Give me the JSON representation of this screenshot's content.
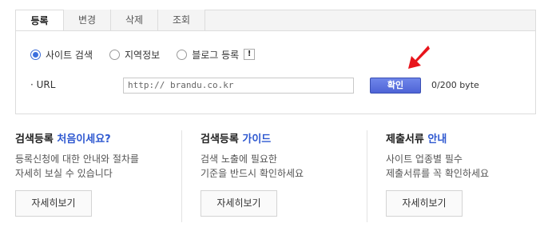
{
  "tabs": [
    {
      "label": "등록",
      "active": true
    },
    {
      "label": "변경",
      "active": false
    },
    {
      "label": "삭제",
      "active": false
    },
    {
      "label": "조회",
      "active": false
    }
  ],
  "form": {
    "radio_options": [
      {
        "label": "사이트 검색",
        "checked": true
      },
      {
        "label": "지역정보",
        "checked": false
      },
      {
        "label": "블로그 등록",
        "checked": false
      }
    ],
    "help_label": "!",
    "url_label": "· URL",
    "url_value": "http:// brandu.co.kr",
    "confirm_label": "확인",
    "byte_count": "0/200 byte"
  },
  "info": [
    {
      "title_prefix": "검색등록 ",
      "title_highlight": "처음이세요?",
      "desc_line1": "등록신청에 대한 안내와 절차를",
      "desc_line2": "자세히 보실 수 있습니다",
      "button_label": "자세히보기"
    },
    {
      "title_prefix": "검색등록 ",
      "title_highlight": "가이드",
      "desc_line1": "검색 노출에 필요한",
      "desc_line2": "기준을 반드시 확인하세요",
      "button_label": "자세히보기"
    },
    {
      "title_prefix": "제출서류 ",
      "title_highlight": "안내",
      "desc_line1": "사이트 업종별 필수",
      "desc_line2": "제출서류를 꼭 확인하세요",
      "button_label": "자세히보기"
    }
  ],
  "colors": {
    "accent": "#2e58d0",
    "button": "#5068dc",
    "arrow": "#e8141b"
  },
  "icons": {
    "help": "exclamation-icon",
    "annotation": "red-arrow-icon"
  }
}
